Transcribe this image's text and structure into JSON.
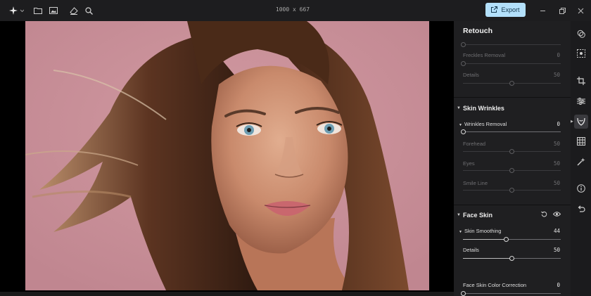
{
  "topbar": {
    "dimensions": "1000 x 667",
    "export_label": "Export",
    "icons": [
      "app-logo-icon",
      "folder-icon",
      "image-icon",
      "eraser-icon",
      "zoom-icon"
    ],
    "window_controls": [
      "minimize-icon",
      "restore-icon",
      "close-icon"
    ]
  },
  "panel": {
    "title": "Retouch",
    "top_group": {
      "freckles_label": "Freckles Removal",
      "freckles_value": "0",
      "freckles_level": 0,
      "details_label": "Details",
      "details_value": "50",
      "details_level": 50,
      "top_slider_level": 0
    },
    "skin_wrinkles": {
      "title": "Skin Wrinkles",
      "wrinkles_label": "Wrinkles Removal",
      "wrinkles_value": "0",
      "wrinkles_level": 0,
      "forehead_label": "Forehead",
      "forehead_value": "50",
      "forehead_level": 50,
      "eyes_label": "Eyes",
      "eyes_value": "50",
      "eyes_level": 50,
      "smile_label": "Smile Line",
      "smile_value": "50",
      "smile_level": 50
    },
    "face_skin": {
      "title": "Face Skin",
      "smoothing_label": "Skin Smoothing",
      "smoothing_value": "44",
      "smoothing_level": 44,
      "details_label": "Details",
      "details_value": "50",
      "details_level": 50,
      "color_label": "Face Skin Color Correction",
      "color_value": "0",
      "color_level": 0
    }
  },
  "colors": {
    "accent": "#b3e0fb",
    "panel_bg": "#1f1f21",
    "backdrop": "#c98e97"
  },
  "right_toolbar": [
    "layers-icon",
    "select-icon",
    "crop-icon",
    "adjust-icon",
    "retouch-icon",
    "transform-icon",
    "magic-icon",
    "info-icon",
    "undo-icon"
  ]
}
